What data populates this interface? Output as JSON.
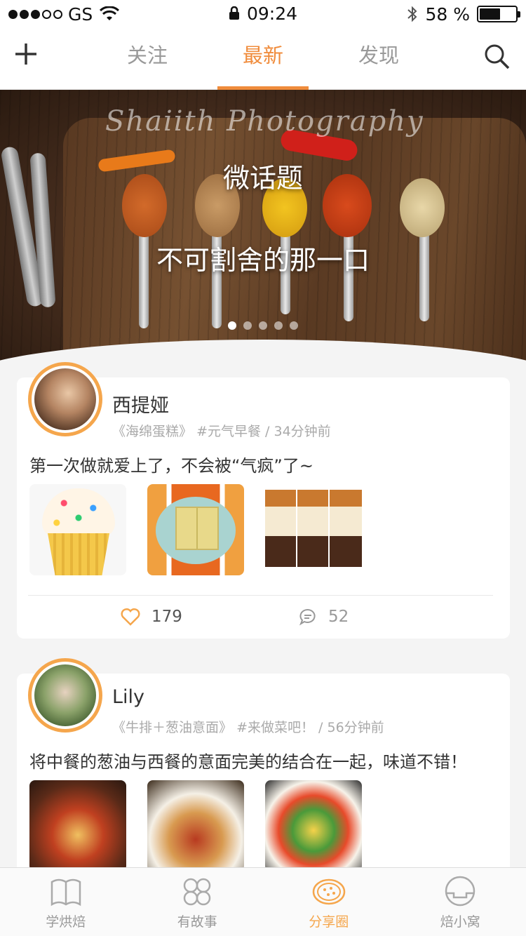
{
  "status": {
    "carrier": "GS",
    "time": "09:24",
    "battery": "58 %",
    "battery_level": 0.58
  },
  "nav": {
    "tabs": [
      {
        "label": "关注",
        "active": false
      },
      {
        "label": "最新",
        "active": true
      },
      {
        "label": "发现",
        "active": false
      }
    ],
    "left_icon": "plus-icon",
    "right_icon": "search-icon"
  },
  "banner": {
    "script_text": "Shaiith Photography",
    "line1": "微话题",
    "line2": "不可割舍的那一口",
    "page_count": 5,
    "current_page": 1
  },
  "posts": [
    {
      "name": "西提娅",
      "book": "《海绵蛋糕》",
      "tag": "#元气早餐",
      "time": "34分钟前",
      "text": "第一次做就爱上了，不会被“气疯”了~",
      "likes": "179",
      "comments": "52"
    },
    {
      "name": "Lily",
      "book": "《牛排＋葱油意面》",
      "tag": "#来做菜吧！",
      "time": "56分钟前",
      "text": "将中餐的葱油与西餐的意面完美的结合在一起，味道不错！"
    }
  ],
  "tabbar": [
    {
      "label": "学烘焙",
      "icon": "book-icon",
      "active": false
    },
    {
      "label": "有故事",
      "icon": "clover-icon",
      "active": false
    },
    {
      "label": "分享圈",
      "icon": "cookie-icon",
      "active": true
    },
    {
      "label": "焙小窝",
      "icon": "home-circle-icon",
      "active": false
    }
  ],
  "colors": {
    "accent": "#f08c3c",
    "avatar_ring": "#f5a64c"
  }
}
